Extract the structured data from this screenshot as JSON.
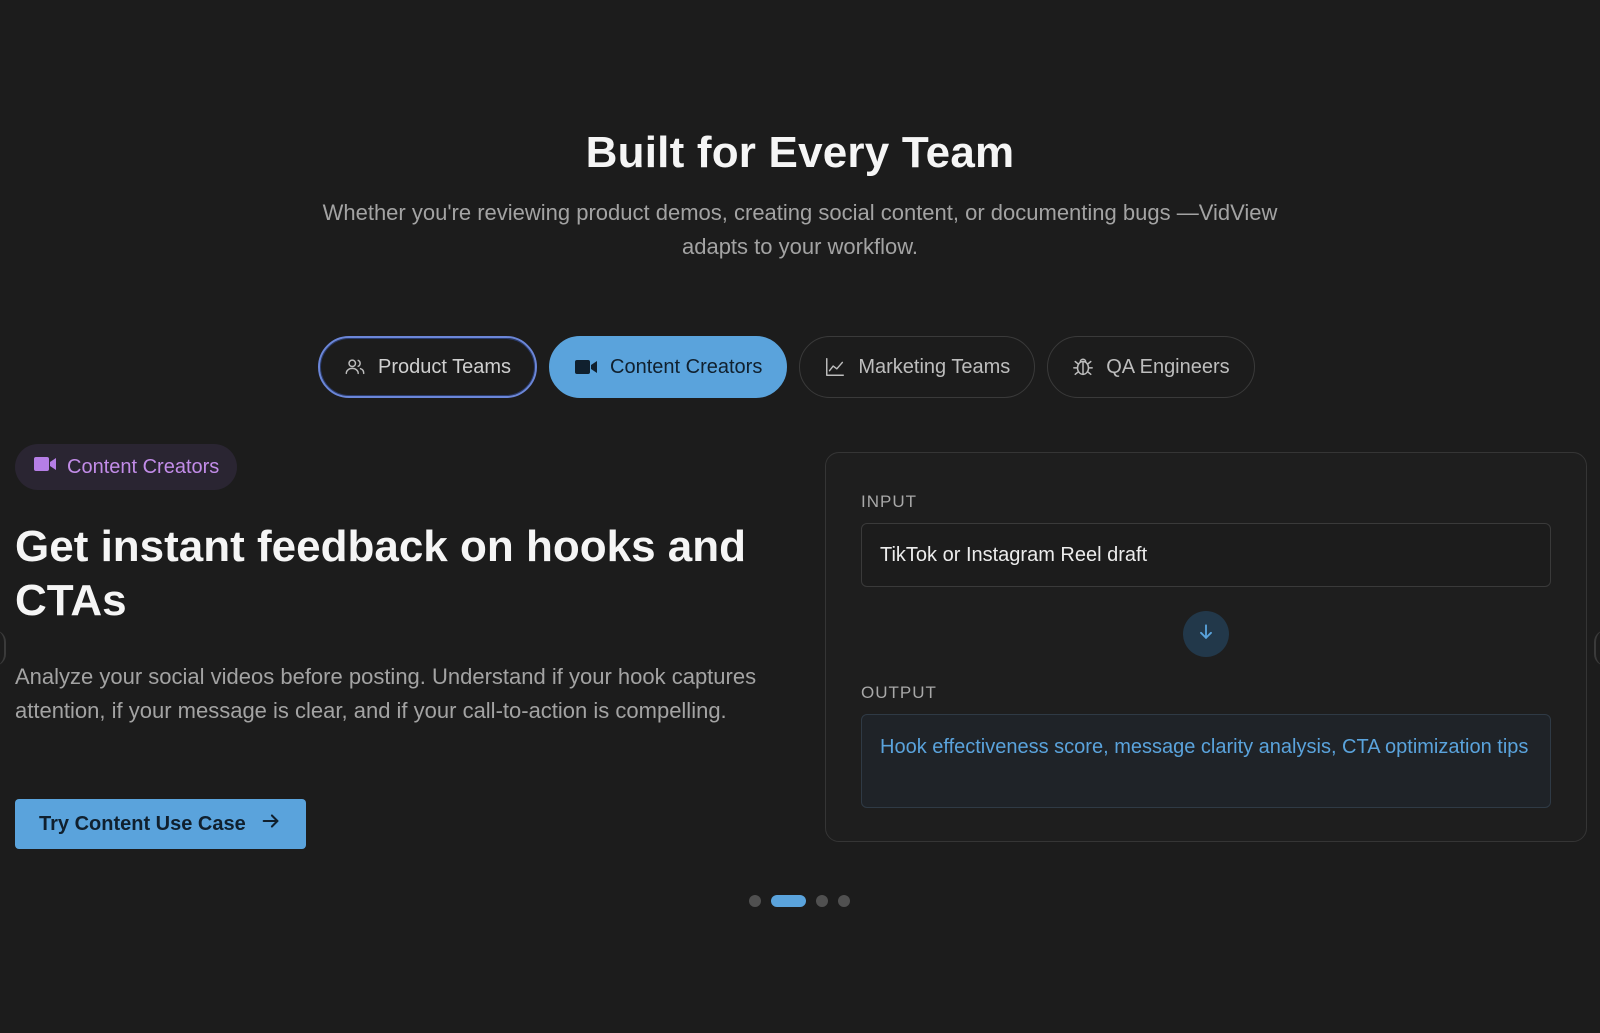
{
  "header": {
    "title": "Built for Every Team",
    "subtitle": "Whether you're reviewing product demos, creating social content, or documenting bugs —VidView adapts to your workflow."
  },
  "tabs": [
    {
      "label": "Product Teams",
      "icon": "users-icon",
      "state": "focused"
    },
    {
      "label": "Content Creators",
      "icon": "video-camera-icon",
      "state": "active"
    },
    {
      "label": "Marketing Teams",
      "icon": "line-chart-icon",
      "state": "default"
    },
    {
      "label": "QA Engineers",
      "icon": "bug-icon",
      "state": "default"
    }
  ],
  "use_case": {
    "badge_label": "Content Creators",
    "badge_icon": "video-camera-icon",
    "headline": "Get instant feedback on hooks and CTAs",
    "description": "Analyze your social videos before posting. Understand if your hook captures attention, if your message is clear, and if your call-to-action is compelling.",
    "cta_label": "Try Content Use Case",
    "cta_icon": "arrow-right-icon"
  },
  "card": {
    "input_label": "INPUT",
    "input_value": "TikTok or Instagram Reel draft",
    "connector_icon": "arrow-down-icon",
    "output_label": "OUTPUT",
    "output_value": "Hook effectiveness score, message clarity analysis, CTA optimization tips"
  },
  "pagination": {
    "count": 4,
    "active_index": 1
  },
  "colors": {
    "background": "#1c1c1c",
    "accent": "#5aa3dc",
    "badge_text": "#c28ce8",
    "badge_background": "#2a2532",
    "focus_ring": "#6b86d8"
  }
}
